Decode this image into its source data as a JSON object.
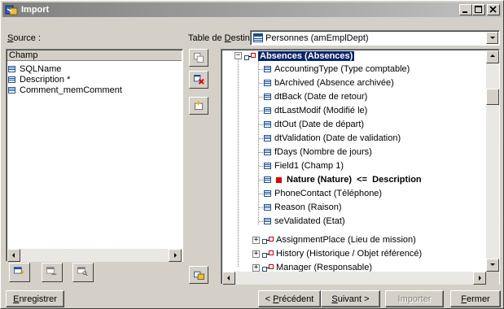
{
  "window": {
    "title": "Import"
  },
  "source": {
    "label": "Source :",
    "label_accel": "S",
    "label_rest": "ource :",
    "header": "Champ",
    "fields": [
      "SQLName",
      "Description *",
      "Comment_memComment"
    ]
  },
  "destination": {
    "label_prefix": "Table de ",
    "label_accel": "D",
    "label_rest": "estination :",
    "selected": "Personnes (amEmplDept)"
  },
  "tree": {
    "root": "Absences (Absences)",
    "children": [
      "AccountingType (Type comptable)",
      "bArchived (Absence archivée)",
      "dtBack (Date de retour)",
      "dtLastModif (Modifié le)",
      "dtOut (Date de départ)",
      "dtValidation (Date de validation)",
      "fDays (Nombre de jours)",
      "Field1 (Champ 1)",
      "Nature (Nature)  <=  Description",
      "PhoneContact (Téléphone)",
      "Reason (Raison)",
      "seValidated (Etat)"
    ],
    "links": [
      "AssignmentPlace (Lieu de mission)",
      "History (Historique / Objet référencé)",
      "Manager (Responsable)"
    ]
  },
  "buttons": {
    "save": {
      "accel": "E",
      "rest": "nregistrer"
    },
    "previous": {
      "prefix": "< ",
      "accel": "P",
      "rest": "récédent"
    },
    "next": {
      "accel": "S",
      "rest": "uivant >"
    },
    "import": "Importer",
    "close": {
      "accel": "F",
      "rest": "ermer"
    }
  },
  "colors": {
    "selection": "#0a246a",
    "mapped_marker": "#e00000",
    "titlebar_start": "#808080",
    "titlebar_end": "#c0c0c0"
  }
}
